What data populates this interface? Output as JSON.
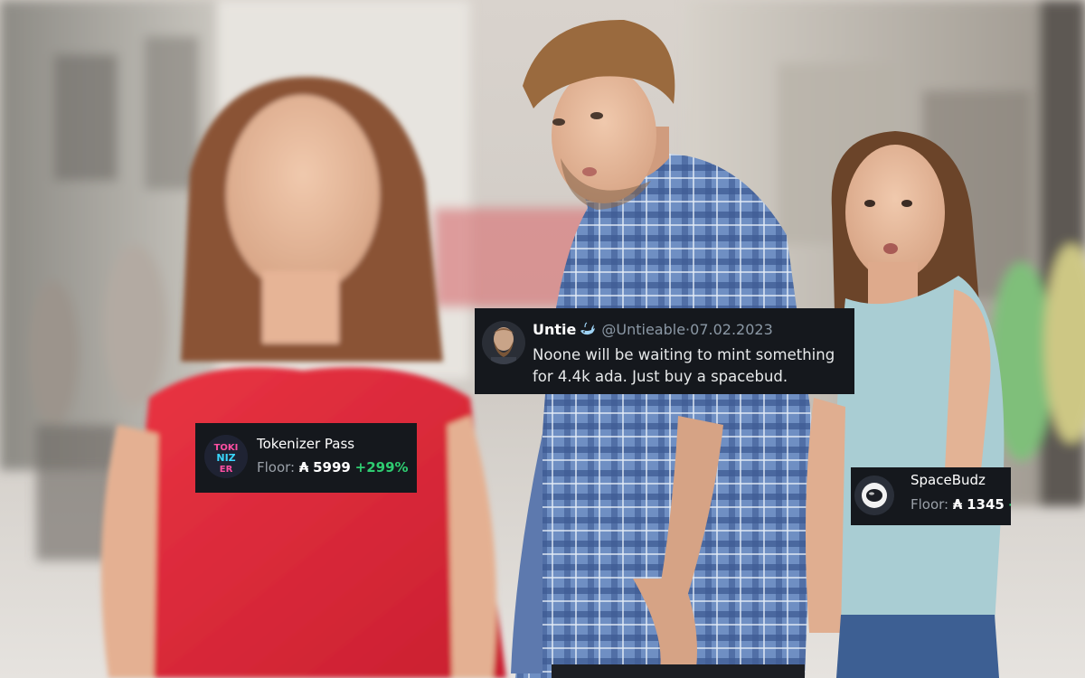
{
  "meme": {
    "labels": {
      "woman_in_red": "Tokenizer Pass",
      "girlfriend": "SpaceBudz"
    }
  },
  "tweet": {
    "name": "Untie",
    "handle": "@Untieable",
    "separator": "·",
    "date": "07.02.2023",
    "text": "Noone will be waiting to mint something for 4.4k ada. Just buy a spacebud.",
    "avatar_icon": "bearded-man-avatar",
    "badge_icon": "whale-icon"
  },
  "tokenizer_pass": {
    "name": "Tokenizer Pass",
    "floor_label": "Floor:",
    "currency_symbol": "₳",
    "floor_price": "5999",
    "change": "+299%",
    "thumb_text": "TOKI NIZ ER",
    "change_color": "#2ecc71"
  },
  "spacebudz": {
    "name": "SpaceBudz",
    "floor_label": "Floor:",
    "currency_symbol": "₳",
    "floor_price": "1345",
    "change": "-",
    "thumb_icon": "astronaut-helmet-icon"
  },
  "colors": {
    "card_bg": "#15181d",
    "red_dress": "#e0283a",
    "plaid_shirt": "#5b7bb4",
    "teal_top": "#a9cdd3"
  }
}
